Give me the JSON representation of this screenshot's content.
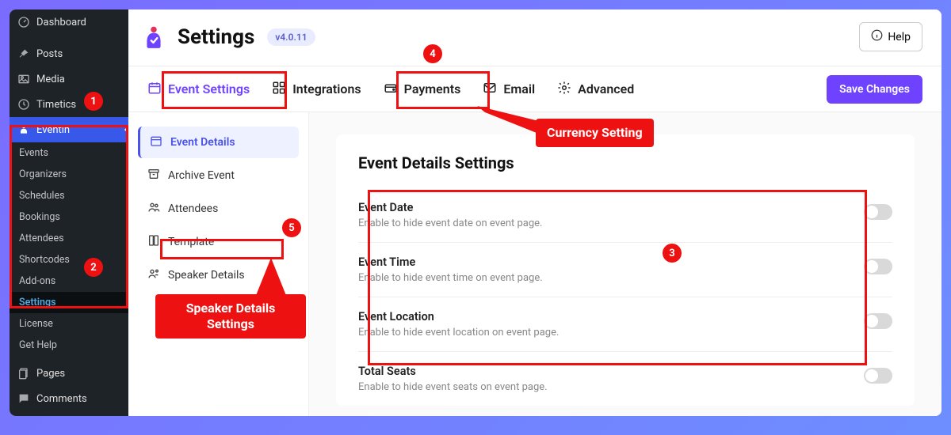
{
  "wp_sidebar": {
    "top_items": [
      {
        "icon": "dashboard",
        "label": "Dashboard"
      },
      {
        "icon": "pin",
        "label": "Posts"
      },
      {
        "icon": "media",
        "label": "Media"
      },
      {
        "icon": "clock",
        "label": "Timetics"
      }
    ],
    "active_item": {
      "icon": "eventin",
      "label": "Eventin"
    },
    "sub_items": [
      "Events",
      "Organizers",
      "Schedules",
      "Bookings",
      "Attendees",
      "Shortcodes",
      "Add-ons",
      "Settings",
      "License",
      "Get Help"
    ],
    "active_sub": "Settings",
    "bottom_items": [
      {
        "icon": "pages",
        "label": "Pages"
      },
      {
        "icon": "comments",
        "label": "Comments"
      }
    ]
  },
  "header": {
    "title": "Settings",
    "version": "v4.0.11",
    "help": "Help"
  },
  "tabs": [
    {
      "icon": "calendar",
      "label": "Event Settings",
      "active": true
    },
    {
      "icon": "grid",
      "label": "Integrations"
    },
    {
      "icon": "wallet",
      "label": "Payments"
    },
    {
      "icon": "mail",
      "label": "Email"
    },
    {
      "icon": "gear",
      "label": "Advanced"
    }
  ],
  "save_label": "Save Changes",
  "subnav": [
    {
      "icon": "calendar",
      "label": "Event Details",
      "active": true
    },
    {
      "icon": "archive",
      "label": "Archive Event"
    },
    {
      "icon": "users",
      "label": "Attendees"
    },
    {
      "icon": "template",
      "label": "Template"
    },
    {
      "icon": "speaker",
      "label": "Speaker Details"
    }
  ],
  "panel": {
    "title": "Event Details Settings",
    "rows": [
      {
        "label": "Event Date",
        "desc": "Enable to hide event date on event page."
      },
      {
        "label": "Event Time",
        "desc": "Enable to hide event time on event page."
      },
      {
        "label": "Event Location",
        "desc": "Enable to hide event location on event page."
      },
      {
        "label": "Total Seats",
        "desc": "Enable to hide event seats on event page."
      }
    ]
  },
  "annotations": {
    "circle1": "1",
    "circle2": "2",
    "circle3": "3",
    "circle4": "4",
    "circle5": "5",
    "currency": "Currency Setting",
    "speaker": "Speaker Details Settings"
  }
}
